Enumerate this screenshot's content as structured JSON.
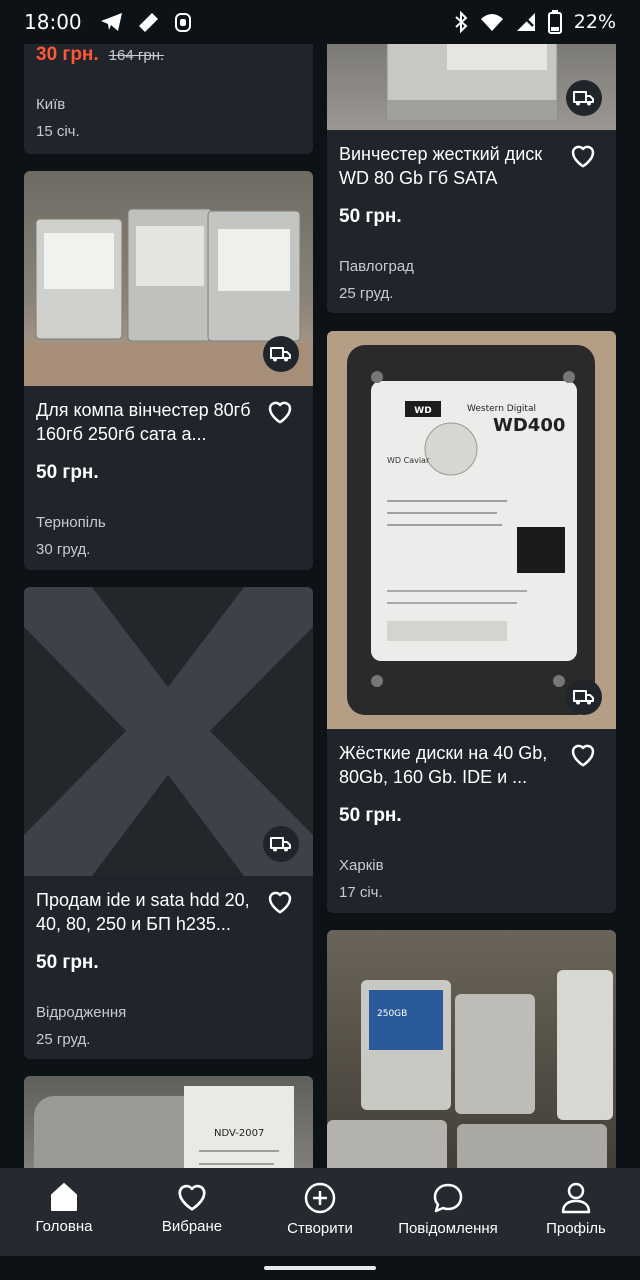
{
  "status_bar": {
    "time": "18:00",
    "battery": "22%",
    "icons": [
      "telegram-icon",
      "rocket-icon",
      "app-icon",
      "bluetooth-icon",
      "wifi-icon",
      "signal-icon",
      "battery-icon"
    ]
  },
  "listings": [
    {
      "id": "top-left",
      "price": "30 грн.",
      "old_price": "164 грн.",
      "city": "Київ",
      "date": "15 січ."
    },
    {
      "id": "seagate-80",
      "title": "Винчестер жесткий диск WD 80 Gb Гб SATA",
      "price": "50 грн.",
      "city": "Павлоград",
      "date": "25 груд.",
      "delivery": true
    },
    {
      "id": "three-drives",
      "title": "Для компа вінчестер 80гб 160гб 250гб сата a...",
      "price": "50 грн.",
      "city": "Тернопіль",
      "date": "30 груд.",
      "delivery": true
    },
    {
      "id": "wd400",
      "title": "Жёсткие диски на 40 Gb, 80Gb, 160 Gb. IDE и ...",
      "price": "50 грн.",
      "city": "Харків",
      "date": "17 січ.",
      "delivery": true,
      "label_lines": [
        "Western Digital",
        "WD400",
        "WD Caviar"
      ]
    },
    {
      "id": "no-photo",
      "title": "Продам ide и sata hdd 20, 40, 80, 250 и БП h235...",
      "price": "50 грн.",
      "city": "Відродження",
      "date": "25 груд.",
      "delivery": true
    },
    {
      "id": "bottom-left-photo",
      "label_lines": [
        "NDV-2007"
      ]
    },
    {
      "id": "bottom-right-photo",
      "label_lines": [
        "250GB"
      ]
    }
  ],
  "tabbar": {
    "home": "Головна",
    "favorites": "Вибране",
    "create": "Створити",
    "messages": "Повідомлення",
    "profile": "Профіль"
  },
  "colors": {
    "background": "#0c1216",
    "card": "#1f252b",
    "discount_price": "#ff5636",
    "tabbar": "#242a30"
  }
}
